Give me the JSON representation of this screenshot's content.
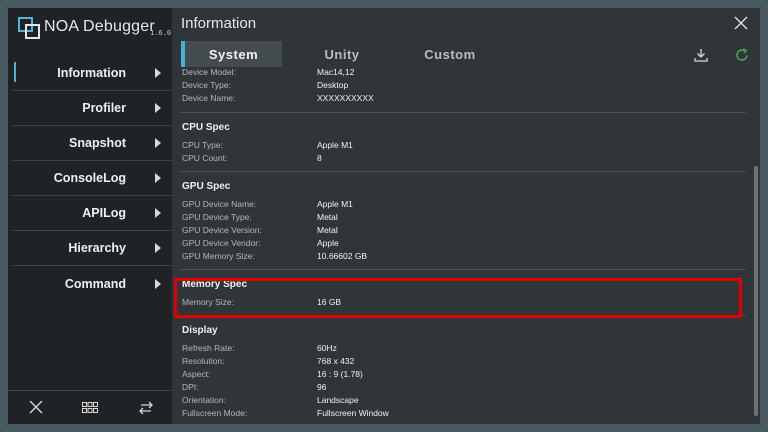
{
  "app": {
    "name": "NOA Debugger",
    "version": "1.6.0"
  },
  "sidebar": {
    "items": [
      {
        "label": "Information",
        "active": true
      },
      {
        "label": "Profiler",
        "active": false
      },
      {
        "label": "Snapshot",
        "active": false
      },
      {
        "label": "ConsoleLog",
        "active": false
      },
      {
        "label": "APILog",
        "active": false
      },
      {
        "label": "Hierarchy",
        "active": false
      },
      {
        "label": "Command",
        "active": false
      }
    ],
    "bottom_icons": [
      "close-icon",
      "grid-icon",
      "swap-arrows-icon"
    ]
  },
  "main": {
    "title": "Information",
    "tabs": [
      {
        "label": "System",
        "active": true
      },
      {
        "label": "Unity",
        "active": false
      },
      {
        "label": "Custom",
        "active": false
      }
    ],
    "tool_icons": [
      "download-icon",
      "refresh-icon"
    ]
  },
  "sections": {
    "device": {
      "rows": [
        {
          "label": "Device Model:",
          "value": "Mac14,12"
        },
        {
          "label": "Device Type:",
          "value": "Desktop"
        },
        {
          "label": "Device Name:",
          "value": "XXXXXXXXXX"
        }
      ]
    },
    "cpu": {
      "title": "CPU Spec",
      "rows": [
        {
          "label": "CPU Type:",
          "value": "Apple M1"
        },
        {
          "label": "CPU Count:",
          "value": "8"
        }
      ]
    },
    "gpu": {
      "title": "GPU Spec",
      "rows": [
        {
          "label": "GPU Device Name:",
          "value": "Apple M1"
        },
        {
          "label": "GPU Device Type:",
          "value": "Metal"
        },
        {
          "label": "GPU Device Version:",
          "value": "Metal"
        },
        {
          "label": "GPU Device Vendor:",
          "value": "Apple"
        },
        {
          "label": "GPU Memory Size:",
          "value": "10.66602 GB"
        }
      ]
    },
    "memory": {
      "title": "Memory Spec",
      "rows": [
        {
          "label": "Memory Size:",
          "value": "16 GB"
        }
      ]
    },
    "display": {
      "title": "Display",
      "rows": [
        {
          "label": "Refresh Rate:",
          "value": "60Hz"
        },
        {
          "label": "Resolution:",
          "value": "768 x 432"
        },
        {
          "label": "Aspect:",
          "value": "16 : 9 (1.78)"
        },
        {
          "label": "DPI:",
          "value": "96"
        },
        {
          "label": "Orientation:",
          "value": "Landscape"
        },
        {
          "label": "Fullscreen Mode:",
          "value": "Fullscreen Window"
        }
      ]
    }
  },
  "colors": {
    "accent": "#3fb6d9",
    "highlight": "#e00000",
    "refresh": "#4caf50"
  }
}
